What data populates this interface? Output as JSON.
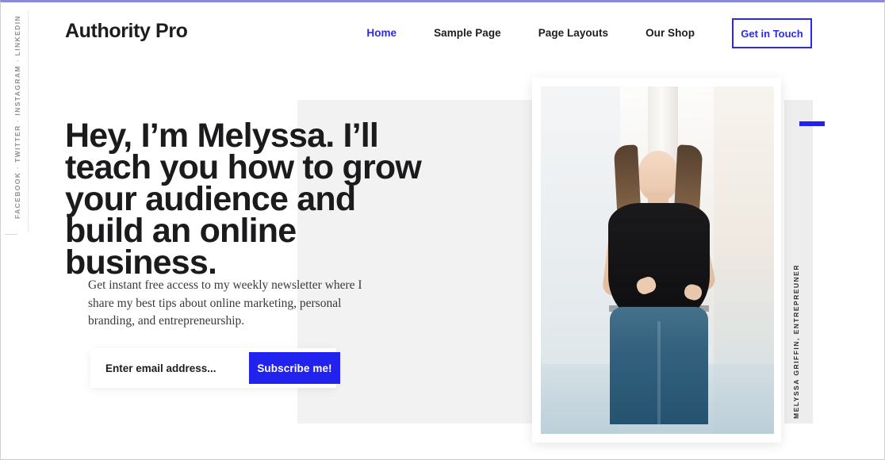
{
  "site": {
    "logo": "Authority Pro"
  },
  "nav": {
    "items": [
      {
        "label": "Home",
        "current": true
      },
      {
        "label": "Sample Page",
        "current": false
      },
      {
        "label": "Page Layouts",
        "current": false
      },
      {
        "label": "Our Shop",
        "current": false
      }
    ],
    "cta_label": "Get in Touch"
  },
  "social": {
    "items": [
      "FACEBOOK",
      "TWITTER",
      "INSTAGRAM",
      "LINKEDIN"
    ],
    "separator": "·",
    "rendered": "FACEBOOK · TWITTER · INSTAGRAM · LINKEDIN"
  },
  "hero": {
    "title": "Hey, I’m Melyssa. I’ll teach you how to grow your audience and build an online business.",
    "subtitle": "Get instant free access to my weekly newsletter where I share my best tips about online marketing, personal branding, and entrepreneurship.",
    "photo_credit": "MELYSSA GRIFFIN, ENTREPREUNER"
  },
  "signup": {
    "email_placeholder": "Enter email address...",
    "email_value": "",
    "submit_label": "Subscribe me!"
  },
  "colors": {
    "accent_blue": "#2222EE",
    "nav_active": "#2A2AEE",
    "text_dark": "#1D1D1F",
    "gray_block": "#F2F2F2",
    "gray_block_right": "#EDEDED",
    "social_text": "#8E8E94"
  }
}
